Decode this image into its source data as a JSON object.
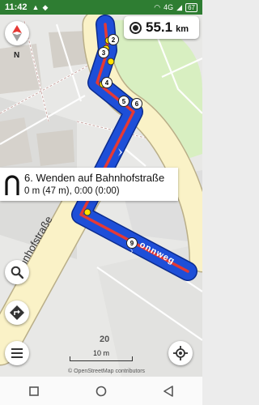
{
  "status_bar": {
    "time": "11:42",
    "network_label": "4G",
    "battery": "67"
  },
  "map": {
    "street_labels": {
      "bahnhofstrasse": "Bahnhofstraße",
      "route_street": "onnweg"
    },
    "building_number": "20",
    "waypoints": [
      "2",
      "3",
      "4",
      "5",
      "6",
      "9"
    ],
    "colors": {
      "route_fill": "#1e4fd8",
      "route_line": "#e53935",
      "road": "#faf2c7",
      "waypoint": "#ffe100"
    }
  },
  "distance": {
    "icon": "target-icon",
    "value": "55.1",
    "unit": "km"
  },
  "compass": {
    "direction_label": "N"
  },
  "turn_instruction": {
    "icon": "u-turn-icon",
    "text": "6. Wenden auf Bahnhofstraße",
    "detail": "0 m (47 m), 0:00 (0:00)"
  },
  "scale_bar": {
    "label": "10 m"
  },
  "attribution": "© OpenStreetMap contributors",
  "buttons": {
    "search": "search-icon",
    "directions": "directions-icon",
    "menu": "menu-icon",
    "my_location": "my-location-icon"
  },
  "nav_bar": {
    "square": "recent-apps-icon",
    "circle": "home-icon",
    "triangle": "back-icon"
  }
}
